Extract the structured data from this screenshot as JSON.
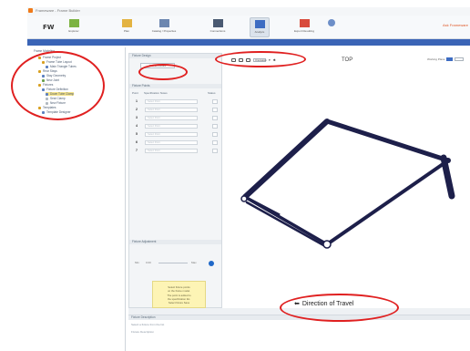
{
  "window": {
    "title": "Frameware - Frame Builder",
    "corner_text": "Ask Frameware"
  },
  "ribbon": {
    "logo": "FW",
    "buttons": [
      {
        "label": "Explorer",
        "icon": "explorer-icon",
        "color": "#7cb342"
      },
      {
        "label": "Plan",
        "icon": "plan-icon",
        "color": "#e3b341"
      },
      {
        "label": "Catalog / Properties",
        "icon": "catalog-icon",
        "color": "#6c87b0"
      },
      {
        "label": "Connections",
        "icon": "connections-icon",
        "color": "#4a5a72"
      },
      {
        "label": "Analyze",
        "icon": "analyze-icon",
        "color": "#3d6cc2"
      },
      {
        "label": "Export Resulting",
        "icon": "export-icon",
        "color": "#d84b3b"
      },
      {
        "label": "Help",
        "icon": "help-icon",
        "color": "#6d8fc8"
      }
    ]
  },
  "tree": {
    "heading": "Frame Modeling",
    "items": [
      {
        "label": "Frame Project",
        "level": 1,
        "icon": "folder-icon",
        "color": "#d8a020"
      },
      {
        "label": "Frame Tube Layout",
        "level": 2,
        "icon": "layout-icon",
        "color": "#d8a020"
      },
      {
        "label": "Main Triangle Tubes",
        "level": 3,
        "icon": "layout-icon",
        "color": "#5a7fc0"
      },
      {
        "label": "Rear Stays",
        "level": 1,
        "icon": "folder-icon",
        "color": "#d8a020"
      },
      {
        "label": "Stay Geometry",
        "level": 2,
        "icon": "layout-icon",
        "color": "#5a7fc0"
      },
      {
        "label": "New Joint",
        "level": 2,
        "icon": "joint-icon",
        "color": "#6aa04a"
      },
      {
        "label": "Fixtures",
        "level": 1,
        "icon": "folder-icon",
        "color": "#d8a020"
      },
      {
        "label": "Fixture Definition",
        "level": 2,
        "icon": "fixture-icon",
        "color": "#5a7fc0"
      },
      {
        "label": "Down Tube Clamp",
        "level": 3,
        "icon": "fixture-icon",
        "color": "#5a7fc0",
        "selected": true
      },
      {
        "label": "Seat Clamp",
        "level": 3,
        "icon": "fixture-icon",
        "color": "#b0b8c0"
      },
      {
        "label": "New Fixture",
        "level": 3,
        "icon": "fixture-icon",
        "color": "#b0b8c0"
      },
      {
        "label": "Templates",
        "level": 1,
        "icon": "folder-icon",
        "color": "#d8a020"
      },
      {
        "label": "Template Designer",
        "level": 2,
        "icon": "template-icon",
        "color": "#5a7fc0"
      }
    ]
  },
  "fixture_panel": {
    "section1": "Fixture Design",
    "select_button": "Select Fixture",
    "section2": "Fixture Points",
    "columns": [
      "Point",
      "Specification Notes",
      "Status"
    ],
    "rows": [
      {
        "num": "1",
        "note": "Select Point"
      },
      {
        "num": "2",
        "note": "Select Point"
      },
      {
        "num": "3",
        "note": "Select Point"
      },
      {
        "num": "4",
        "note": "Select Point"
      },
      {
        "num": "5",
        "note": "Select Point"
      },
      {
        "num": "6",
        "note": "Select Point"
      },
      {
        "num": "7",
        "note": "Select Point"
      }
    ],
    "section3": "Fixture Adjustment",
    "pos_min": "Min",
    "pos_mid": "0.00",
    "pos_max": "Max",
    "note_lines": [
      "Select fixture points",
      "on the frame model.",
      "The point is added to",
      "the specification list.",
      "Select fixture Save"
    ]
  },
  "view": {
    "toolbar_dropdown": "Orientation",
    "view_name": "TOP",
    "right_label": "Working Plane",
    "direction_arrow": "⬅",
    "direction_text": "Direction of Travel"
  },
  "bottom_panel": {
    "header": "Fixture Description",
    "line1": "Select a fixture from the list",
    "line2": "Fixture Description"
  },
  "colors": {
    "accent": "#3a64b6",
    "annotation": "#e02020",
    "frame": "#1d1f4a",
    "note_bg": "#fdf4b5"
  }
}
